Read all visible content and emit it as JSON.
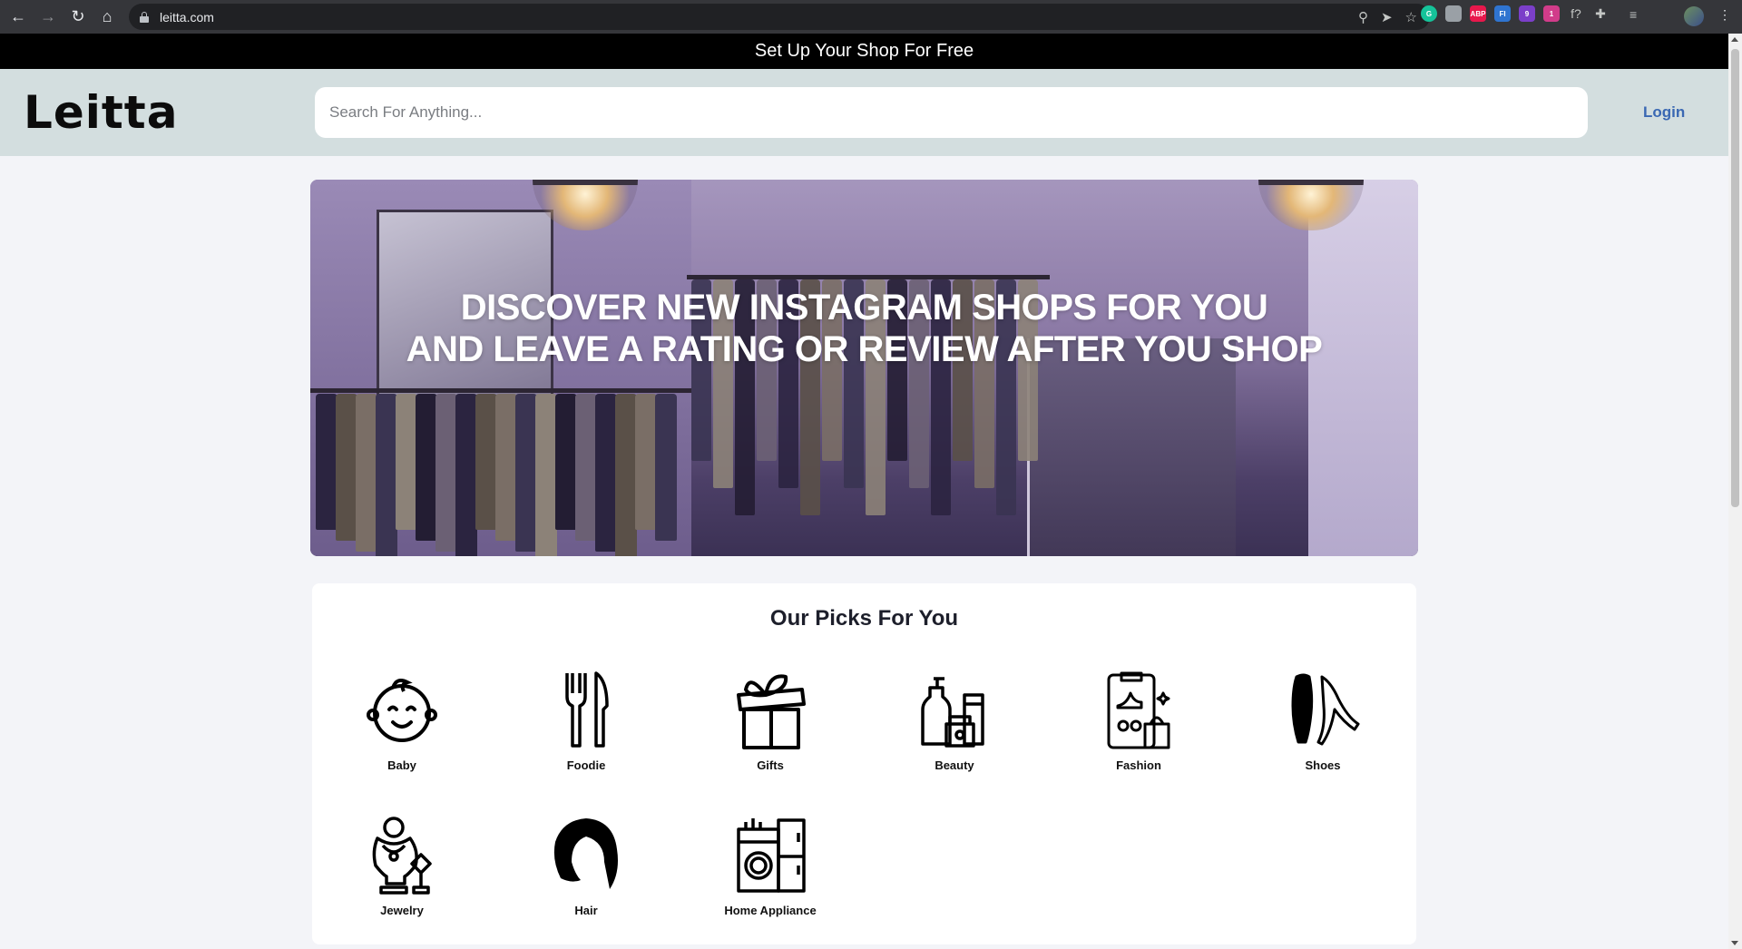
{
  "browser": {
    "url": "leitta.com",
    "extensions": [
      {
        "name": "grammarly-icon",
        "label": "G",
        "color": "#15c39a"
      },
      {
        "name": "extension-gray-icon",
        "label": "",
        "color": "#9aa0a6"
      },
      {
        "name": "adblock-icon",
        "label": "ABP",
        "color": "#e8184c"
      },
      {
        "name": "fi-extension-icon",
        "label": "FI",
        "color": "#2f74d0"
      },
      {
        "name": "purple-extension-icon",
        "label": "9",
        "color": "#7b3fc9"
      },
      {
        "name": "pink-extension-icon",
        "label": "1",
        "color": "#d13c8a"
      }
    ]
  },
  "topbar": {
    "text": "Set Up Your Shop For Free"
  },
  "header": {
    "logo": "Leitta",
    "search_placeholder": "Search For Anything...",
    "login": "Login"
  },
  "hero": {
    "line1": "DISCOVER NEW INSTAGRAM SHOPS FOR YOU",
    "line2": "AND LEAVE A RATING OR REVIEW AFTER YOU SHOP"
  },
  "picks": {
    "title": "Our Picks For You",
    "categories": [
      {
        "label": "Baby",
        "icon": "baby-icon"
      },
      {
        "label": "Foodie",
        "icon": "fork-knife-icon"
      },
      {
        "label": "Gifts",
        "icon": "gift-icon"
      },
      {
        "label": "Beauty",
        "icon": "beauty-products-icon"
      },
      {
        "label": "Fashion",
        "icon": "fashion-icon"
      },
      {
        "label": "Shoes",
        "icon": "shoes-icon"
      },
      {
        "label": "Jewelry",
        "icon": "jewelry-icon"
      },
      {
        "label": "Hair",
        "icon": "hair-icon"
      },
      {
        "label": "Home Appliance",
        "icon": "home-appliance-icon"
      }
    ]
  }
}
